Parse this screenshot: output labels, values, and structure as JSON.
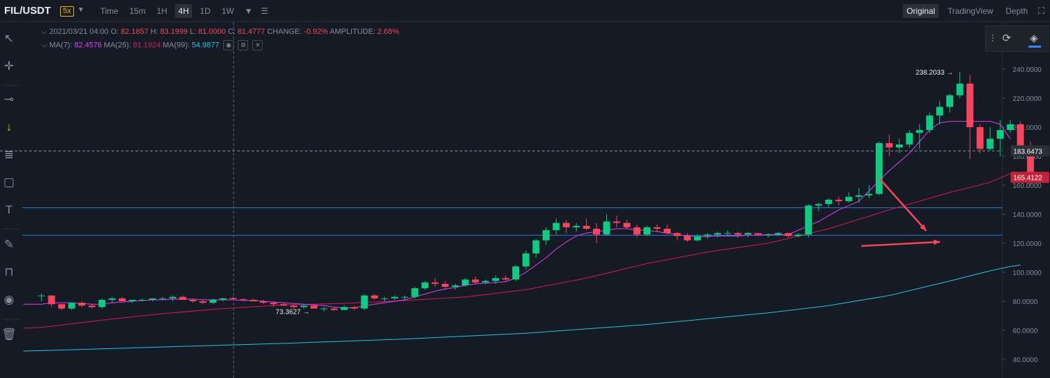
{
  "header": {
    "symbol": "FIL/USDT",
    "leverage": "5x",
    "intervals": [
      "Time",
      "15m",
      "1H",
      "4H",
      "1D",
      "1W"
    ],
    "active_interval": "4H",
    "views": [
      "Original",
      "TradingView",
      "Depth"
    ],
    "active_view": "Original"
  },
  "legend": {
    "date": "2021/03/21 04:00",
    "o_label": "O:",
    "o": "82.1857",
    "h_label": "H:",
    "h": "83.1999",
    "l_label": "L:",
    "l": "81.0000",
    "c_label": "C:",
    "c": "81.4777",
    "change_label": "CHANGE:",
    "change": "-0.92%",
    "amp_label": "AMPLITUDE:",
    "amp": "2.68%",
    "ma7_label": "MA(7):",
    "ma7": "82.4576",
    "ma25_label": "MA(25):",
    "ma25": "81.1924",
    "ma99_label": "MA(99):",
    "ma99": "54.9877"
  },
  "colors": {
    "up": "#0ecb81",
    "down": "#f6465d",
    "ma7": "#e040fb",
    "ma25": "#d81b60",
    "ma99": "#26c6da",
    "hline": "#2f6cbf",
    "arrow": "#f6465d",
    "bg": "#161a25",
    "accent": "#f0b90b"
  },
  "chart_data": {
    "type": "candlestick",
    "y_ticks": [
      "240.0000",
      "220.0000",
      "200.0000",
      "180.0000",
      "160.0000",
      "140.0000",
      "120.0000",
      "100.0000",
      "80.0000",
      "60.0000",
      "40.0000"
    ],
    "ylim": [
      32,
      253
    ],
    "last_price_label": "165.4122",
    "crosshair_price_label": "183.6473",
    "crosshair_price": 183.6473,
    "max_label": "238.2033",
    "min_label": "73.3627",
    "horizontal_levels": [
      144.5,
      125.5
    ],
    "candles": [
      [
        84,
        85.5,
        80,
        84
      ],
      [
        84,
        84,
        76,
        78
      ],
      [
        78,
        78,
        74,
        75
      ],
      [
        75,
        79,
        74,
        79
      ],
      [
        79,
        80,
        76,
        77
      ],
      [
        77,
        78,
        75,
        76
      ],
      [
        76,
        82,
        75,
        81
      ],
      [
        81,
        83,
        79,
        82
      ],
      [
        82,
        83,
        80,
        80
      ],
      [
        80,
        81,
        79,
        81
      ],
      [
        81,
        82,
        80,
        81
      ],
      [
        81,
        82,
        80,
        82
      ],
      [
        82,
        83,
        81,
        82
      ],
      [
        82,
        84,
        80,
        83
      ],
      [
        83,
        84,
        81,
        81
      ],
      [
        81,
        82,
        79,
        80
      ],
      [
        80,
        81,
        78,
        79
      ],
      [
        79,
        82,
        78,
        81
      ],
      [
        81,
        82.5,
        80,
        82
      ],
      [
        82.1857,
        83.1999,
        81.0,
        81.4777
      ],
      [
        81.5,
        82,
        80,
        81
      ],
      [
        81,
        82,
        80,
        80
      ],
      [
        80,
        81,
        78,
        79
      ],
      [
        79,
        80,
        76,
        78
      ],
      [
        78,
        79,
        77,
        77
      ],
      [
        77,
        78,
        75,
        76
      ],
      [
        76,
        78,
        75,
        77
      ],
      [
        77,
        78,
        75,
        75
      ],
      [
        75,
        76,
        73,
        75
      ],
      [
        75,
        76,
        73.3627,
        74
      ],
      [
        74,
        77,
        74,
        76
      ],
      [
        76,
        77,
        74,
        75
      ],
      [
        75,
        85,
        74,
        84
      ],
      [
        84,
        85,
        81,
        82
      ],
      [
        82,
        83,
        80,
        82
      ],
      [
        82,
        84,
        81,
        83
      ],
      [
        83,
        84,
        81,
        83
      ],
      [
        83,
        90,
        82,
        89
      ],
      [
        89,
        94,
        88,
        93
      ],
      [
        93,
        96,
        90,
        92
      ],
      [
        92,
        94,
        88,
        90
      ],
      [
        90,
        92,
        88,
        91
      ],
      [
        91,
        96,
        90,
        95
      ],
      [
        95,
        97,
        92,
        93
      ],
      [
        93,
        95,
        92,
        94
      ],
      [
        94,
        98,
        92,
        96
      ],
      [
        96,
        98,
        94,
        95
      ],
      [
        95,
        105,
        94,
        104
      ],
      [
        104,
        115,
        102,
        113
      ],
      [
        113,
        123,
        110,
        122
      ],
      [
        122,
        131,
        119,
        129
      ],
      [
        129,
        137,
        126,
        134
      ],
      [
        134,
        136,
        127,
        131
      ],
      [
        131,
        134,
        128,
        132
      ],
      [
        132,
        137,
        129,
        130
      ],
      [
        130,
        134,
        120,
        126
      ],
      [
        126,
        140,
        125,
        135
      ],
      [
        135,
        139,
        131,
        134
      ],
      [
        134,
        136,
        130,
        131
      ],
      [
        131,
        133,
        124,
        126
      ],
      [
        126,
        132,
        125,
        131
      ],
      [
        131,
        133,
        128,
        130
      ],
      [
        130,
        133,
        126,
        127
      ],
      [
        127,
        128,
        122,
        125
      ],
      [
        125,
        127,
        121,
        122
      ],
      [
        122,
        126,
        121,
        125
      ],
      [
        125,
        127,
        123,
        126
      ],
      [
        126,
        128,
        124,
        127
      ],
      [
        127,
        129,
        125,
        127
      ],
      [
        127,
        128,
        124,
        126
      ],
      [
        126,
        128,
        124,
        127
      ],
      [
        127,
        127,
        125,
        126
      ],
      [
        126,
        127,
        124,
        126
      ],
      [
        126,
        128,
        125,
        127
      ],
      [
        127,
        127,
        124,
        125
      ],
      [
        125,
        127,
        124,
        126
      ],
      [
        126,
        147,
        124,
        146
      ],
      [
        146,
        148,
        142,
        147
      ],
      [
        147,
        151,
        145,
        150
      ],
      [
        150,
        152,
        146,
        149
      ],
      [
        149,
        155,
        148,
        152
      ],
      [
        152,
        158,
        148,
        153
      ],
      [
        153,
        160,
        151,
        154
      ],
      [
        154,
        190,
        153,
        189
      ],
      [
        189,
        195,
        180,
        186
      ],
      [
        186,
        192,
        182,
        188
      ],
      [
        188,
        198,
        186,
        196
      ],
      [
        196,
        202,
        185,
        198
      ],
      [
        198,
        210,
        196,
        208
      ],
      [
        208,
        218,
        202,
        214
      ],
      [
        214,
        223,
        210,
        222
      ],
      [
        222,
        238.2033,
        220,
        230
      ],
      [
        230,
        236,
        178,
        200
      ],
      [
        200,
        202,
        182,
        185
      ],
      [
        185,
        200,
        184,
        192
      ],
      [
        192,
        205,
        180,
        198
      ],
      [
        198,
        205,
        196,
        202
      ],
      [
        202,
        204,
        184,
        186
      ],
      [
        186,
        190,
        160,
        165.4122
      ]
    ],
    "ma7": [
      [
        0,
        78
      ],
      [
        1,
        79
      ],
      [
        2,
        79
      ],
      [
        3,
        79
      ],
      [
        4,
        78.5
      ],
      [
        5,
        78
      ],
      [
        6,
        78
      ],
      [
        7,
        79
      ],
      [
        8,
        79.5
      ],
      [
        9,
        80
      ],
      [
        10,
        80.5
      ],
      [
        11,
        81
      ],
      [
        12,
        81
      ],
      [
        13,
        81.5
      ],
      [
        14,
        81.5
      ],
      [
        15,
        81.5
      ],
      [
        16,
        81
      ],
      [
        17,
        81
      ],
      [
        18,
        81
      ],
      [
        19,
        81
      ],
      [
        20,
        80.5
      ],
      [
        21,
        80.5
      ],
      [
        22,
        80
      ],
      [
        23,
        79.5
      ],
      [
        24,
        79
      ],
      [
        25,
        78.5
      ],
      [
        26,
        78
      ],
      [
        27,
        77.5
      ],
      [
        28,
        77
      ],
      [
        29,
        76
      ],
      [
        30,
        75.5
      ],
      [
        31,
        75.5
      ],
      [
        32,
        77
      ],
      [
        33,
        78
      ],
      [
        34,
        79
      ],
      [
        35,
        80
      ],
      [
        36,
        81
      ],
      [
        37,
        83
      ],
      [
        38,
        85
      ],
      [
        39,
        87
      ],
      [
        40,
        88.5
      ],
      [
        41,
        89.5
      ],
      [
        42,
        91
      ],
      [
        43,
        92
      ],
      [
        44,
        92.5
      ],
      [
        45,
        93
      ],
      [
        46,
        93.5
      ],
      [
        47,
        96
      ],
      [
        48,
        100
      ],
      [
        49,
        105
      ],
      [
        50,
        110
      ],
      [
        51,
        116
      ],
      [
        52,
        121
      ],
      [
        53,
        125
      ],
      [
        54,
        127
      ],
      [
        55,
        128
      ],
      [
        56,
        129
      ],
      [
        57,
        130
      ],
      [
        58,
        130
      ],
      [
        59,
        129
      ],
      [
        60,
        129
      ],
      [
        61,
        128
      ],
      [
        62,
        127
      ],
      [
        63,
        126
      ],
      [
        64,
        125
      ],
      [
        65,
        124.5
      ],
      [
        66,
        124.5
      ],
      [
        67,
        125
      ],
      [
        68,
        125
      ],
      [
        69,
        125
      ],
      [
        70,
        125.5
      ],
      [
        71,
        125.5
      ],
      [
        72,
        126
      ],
      [
        73,
        126
      ],
      [
        74,
        126
      ],
      [
        75,
        129
      ],
      [
        76,
        132
      ],
      [
        77,
        135
      ],
      [
        78,
        139
      ],
      [
        79,
        143
      ],
      [
        80,
        146
      ],
      [
        81,
        149
      ],
      [
        82,
        156
      ],
      [
        83,
        163
      ],
      [
        84,
        170
      ],
      [
        85,
        176
      ],
      [
        86,
        182
      ],
      [
        87,
        190
      ],
      [
        88,
        198
      ],
      [
        89,
        203
      ],
      [
        90,
        204
      ],
      [
        91,
        204
      ],
      [
        92,
        204
      ],
      [
        93,
        204
      ],
      [
        94,
        204
      ],
      [
        95,
        202
      ],
      [
        96,
        192
      ]
    ],
    "ma25": [
      [
        0,
        62
      ],
      [
        6,
        67
      ],
      [
        12,
        71.5
      ],
      [
        18,
        75
      ],
      [
        24,
        77.5
      ],
      [
        30,
        78.5
      ],
      [
        36,
        80.5
      ],
      [
        42,
        83
      ],
      [
        48,
        88
      ],
      [
        54,
        96
      ],
      [
        60,
        106
      ],
      [
        66,
        114
      ],
      [
        72,
        120
      ],
      [
        78,
        130
      ],
      [
        84,
        143
      ],
      [
        90,
        155
      ],
      [
        94,
        162
      ],
      [
        96,
        168
      ]
    ],
    "ma99": [
      [
        0,
        46
      ],
      [
        12,
        48.5
      ],
      [
        24,
        51
      ],
      [
        36,
        54
      ],
      [
        48,
        58
      ],
      [
        60,
        64
      ],
      [
        72,
        72
      ],
      [
        78,
        77
      ],
      [
        84,
        84
      ],
      [
        90,
        94
      ],
      [
        94,
        101
      ],
      [
        96,
        104
      ],
      [
        97,
        105
      ]
    ]
  }
}
